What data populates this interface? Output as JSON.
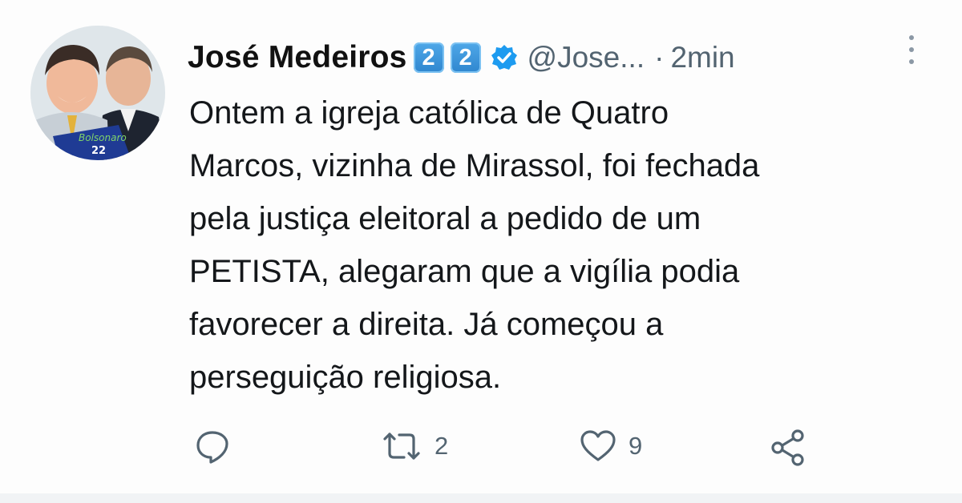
{
  "author": {
    "display_name": "José Medeiros",
    "emoji_1": "2",
    "emoji_2": "2",
    "handle": "@Jose...",
    "separator": "·",
    "time": "2min",
    "avatar_text_1": "Bolsonaro",
    "avatar_text_2": "22"
  },
  "tweet": {
    "lines": [
      "Ontem a igreja católica de Quatro",
      "Marcos, vizinha de Mirassol, foi fechada",
      "pela justiça eleitoral a pedido de um",
      "PETISTA, alegaram que a vigília podia",
      "favorecer a direita. Já começou a",
      "perseguição religiosa."
    ]
  },
  "actions": {
    "reply_count": "",
    "retweet_count": "2",
    "like_count": "9"
  },
  "colors": {
    "verified": "#1d9bf0",
    "secondary_text": "#536471",
    "keycap": "#3b95dc"
  }
}
